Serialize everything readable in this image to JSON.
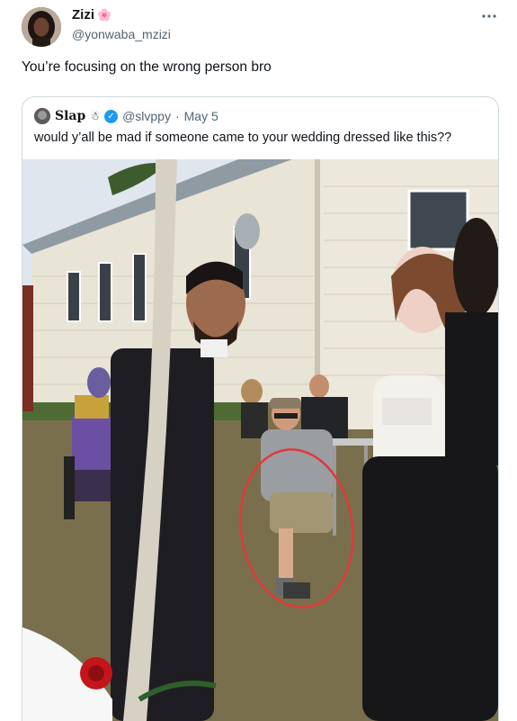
{
  "tweet": {
    "author_name": "Zizi",
    "author_emoji": "🌸",
    "author_handle": "@yonwaba_mzizi",
    "more_icon": "more-dots-icon",
    "text": "You’re focusing on the wrong person bro"
  },
  "quoted": {
    "author_name": "Slap",
    "author_emoji": "☃",
    "handle": "@slvppy",
    "separator": "·",
    "date": "May 5",
    "verified": true,
    "text": "would y’all be mad if someone came to your wedding dressed like this??"
  },
  "colors": {
    "text": "#0f1419",
    "secondary": "#536471",
    "border": "#cfd9de",
    "verified": "#1d9bf0",
    "highlight_circle": "#e0393a"
  }
}
